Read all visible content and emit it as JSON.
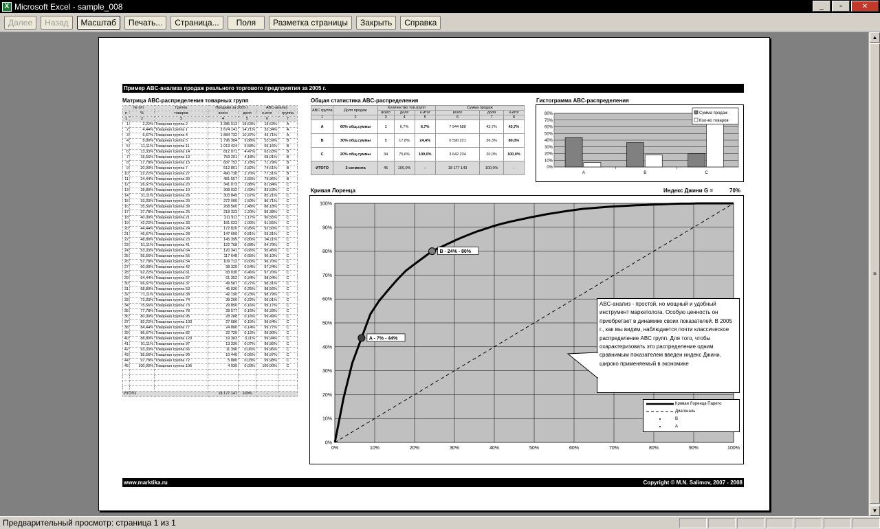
{
  "window": {
    "title": "Microsoft Excel - sample_008"
  },
  "toolbar": {
    "buttons": [
      "Далее",
      "Назад",
      "Масштаб",
      "Печать...",
      "Страница...",
      "Поля",
      "Разметка страницы",
      "Закрыть",
      "Справка"
    ]
  },
  "status": "Предварительный просмотр: страница 1 из 1",
  "sheet": {
    "header": "Пример ABC-анализа продаж реального торгового предприятия за 2005 г.",
    "footer_left": "www.marktika.ru",
    "footer_right": "Copyright © M.N. Salimov, 2007 - 2008",
    "matrix": {
      "title": "Матрица ABC-распределения товарных групп",
      "head1": [
        "№ п/п",
        "Группа",
        "Продажи за 2005 г.",
        "",
        "ABC-анализ",
        ""
      ],
      "head2": [
        "п",
        "%",
        "товаров",
        "всего",
        "доля",
        "н.итог",
        "группа"
      ],
      "head3": [
        "1",
        "2",
        "3",
        "4",
        "5",
        "6",
        "7"
      ],
      "rows": [
        [
          "1",
          "2,22%",
          "Товарная группа 2",
          "3 385 013",
          "18,63%",
          "18,63%",
          "A"
        ],
        [
          "2",
          "4,44%",
          "Товарная группа 1",
          "2 674 141",
          "14,71%",
          "33,34%",
          "A"
        ],
        [
          "3",
          "6,67%",
          "Товарная группа 4",
          "1 884 732",
          "10,37%",
          "43,71%",
          "A"
        ],
        [
          "4",
          "8,89%",
          "Товарная группа 5",
          "1 796 384",
          "9,88%",
          "53,59%",
          "B"
        ],
        [
          "5",
          "11,11%",
          "Товарная группа 11",
          "1 013 424",
          "5,58%",
          "59,16%",
          "B"
        ],
        [
          "6",
          "13,33%",
          "Товарная группа 14",
          "812 071",
          "4,47%",
          "63,63%",
          "B"
        ],
        [
          "7",
          "15,56%",
          "Товарная группа 13",
          "759 201",
          "4,18%",
          "68,01%",
          "B"
        ],
        [
          "8",
          "17,78%",
          "Товарная группа 15",
          "687 752",
          "3,78%",
          "71,79%",
          "B"
        ],
        [
          "9",
          "20,00%",
          "Товарная группа 7",
          "512 851",
          "2,82%",
          "74,61%",
          "B"
        ],
        [
          "10",
          "22,22%",
          "Товарная группа 27",
          "490 738",
          "2,70%",
          "77,31%",
          "B"
        ],
        [
          "11",
          "24,44%",
          "Товарная группа 30",
          "481 557",
          "2,65%",
          "79,96%",
          "B"
        ],
        [
          "12",
          "26,67%",
          "Товарная группа 20",
          "341 073",
          "1,88%",
          "81,84%",
          "C"
        ],
        [
          "13",
          "28,89%",
          "Товарная группа 10",
          "308 032",
          "1,69%",
          "83,53%",
          "C"
        ],
        [
          "14",
          "31,11%",
          "Товарная группа 26",
          "303 849",
          "1,67%",
          "85,21%",
          "C"
        ],
        [
          "15",
          "33,33%",
          "Товарная группа 29",
          "272 000",
          "1,50%",
          "86,71%",
          "C"
        ],
        [
          "16",
          "35,56%",
          "Товарная группа 39",
          "268 560",
          "1,48%",
          "88,18%",
          "C"
        ],
        [
          "17",
          "37,78%",
          "Товарная группа 25",
          "218 323",
          "1,20%",
          "89,38%",
          "C"
        ],
        [
          "18",
          "40,00%",
          "Товарная группа 21",
          "211 911",
          "1,17%",
          "90,55%",
          "C"
        ],
        [
          "19",
          "42,22%",
          "Товарная группа 33",
          "181 623",
          "1,00%",
          "91,55%",
          "C"
        ],
        [
          "20",
          "44,44%",
          "Товарная группа 24",
          "172 820",
          "0,95%",
          "92,50%",
          "C"
        ],
        [
          "21",
          "46,67%",
          "Товарная группа 28",
          "147 609",
          "0,81%",
          "93,31%",
          "C"
        ],
        [
          "22",
          "48,89%",
          "Товарная группа 23",
          "145 399",
          "0,80%",
          "94,11%",
          "C"
        ],
        [
          "23",
          "51,11%",
          "Товарная группа 41",
          "122 768",
          "0,68%",
          "94,79%",
          "C"
        ],
        [
          "24",
          "53,33%",
          "Товарная группа 64",
          "120 341",
          "0,66%",
          "95,45%",
          "C"
        ],
        [
          "25",
          "55,56%",
          "Товарная группа 56",
          "117 648",
          "0,65%",
          "96,10%",
          "C"
        ],
        [
          "26",
          "57,78%",
          "Товарная группа 54",
          "109 712",
          "0,60%",
          "96,70%",
          "C"
        ],
        [
          "27",
          "60,00%",
          "Товарная группа 42",
          "98 320",
          "0,54%",
          "97,24%",
          "C"
        ],
        [
          "28",
          "62,22%",
          "Товарная группа 61",
          "83 030",
          "0,46%",
          "97,70%",
          "C"
        ],
        [
          "29",
          "64,44%",
          "Товарная группа 67",
          "61 352",
          "0,34%",
          "98,04%",
          "C"
        ],
        [
          "30",
          "66,67%",
          "Товарная группа 37",
          "49 587",
          "0,27%",
          "98,31%",
          "C"
        ],
        [
          "31",
          "68,89%",
          "Товарная группа 53",
          "45 036",
          "0,25%",
          "98,56%",
          "C"
        ],
        [
          "32",
          "71,11%",
          "Товарная группа 38",
          "42 190",
          "0,23%",
          "98,79%",
          "C"
        ],
        [
          "33",
          "73,33%",
          "Товарная группа 74",
          "39 200",
          "0,22%",
          "99,01%",
          "C"
        ],
        [
          "34",
          "75,56%",
          "Товарная группа 73",
          "29 850",
          "0,16%",
          "99,17%",
          "C"
        ],
        [
          "35",
          "77,78%",
          "Товарная группа 78",
          "28 577",
          "0,16%",
          "99,33%",
          "C"
        ],
        [
          "36",
          "80,00%",
          "Товарная группа 95",
          "28 288",
          "0,16%",
          "99,49%",
          "C"
        ],
        [
          "37",
          "82,22%",
          "Товарная группа 103",
          "27 686",
          "0,15%",
          "99,64%",
          "C"
        ],
        [
          "38",
          "84,44%",
          "Товарная группа 77",
          "24 880",
          "0,14%",
          "99,77%",
          "C"
        ],
        [
          "39",
          "86,67%",
          "Товарная группа 82",
          "22 720",
          "0,12%",
          "99,90%",
          "C"
        ],
        [
          "40",
          "88,89%",
          "Товарная группа 129",
          "19 383",
          "0,11%",
          "99,94%",
          "C"
        ],
        [
          "41",
          "91,11%",
          "Товарная группа 97",
          "13 336",
          "0,07%",
          "99,95%",
          "C"
        ],
        [
          "42",
          "93,33%",
          "Товарная группа 66",
          "11 396",
          "0,06%",
          "99,96%",
          "C"
        ],
        [
          "43",
          "95,56%",
          "Товарная группа 99",
          "10 440",
          "0,06%",
          "99,97%",
          "C"
        ],
        [
          "44",
          "97,78%",
          "Товарная группа 72",
          "5 880",
          "0,03%",
          "99,98%",
          "C"
        ],
        [
          "45",
          "100,00%",
          "Товарная группа 106",
          "4 930",
          "0,03%",
          "100,00%",
          "C"
        ]
      ],
      "total": [
        "ИТОГО",
        "",
        "18 177 147",
        "100%",
        "-",
        ""
      ]
    },
    "stats": {
      "title": "Общая статистика ABC-распределения",
      "h1": [
        "ABC группа",
        "Доля продаж",
        "Количество тов.групп",
        "Сумма продаж"
      ],
      "h2": [
        "всего",
        "доля",
        "н.итог",
        "всего",
        "доля",
        "н.итог"
      ],
      "h3": [
        "1",
        "2",
        "3",
        "4",
        "5",
        "6",
        "7",
        "8"
      ],
      "rows": [
        [
          "A",
          "60% общ.суммы",
          "3",
          "6,7%",
          "6,7%",
          "7 944 688",
          "43,7%",
          "43,7%"
        ],
        [
          "B",
          "30% общ.суммы",
          "8",
          "17,8%",
          "24,4%",
          "6 590 221",
          "36,3%",
          "80,0%"
        ],
        [
          "C",
          "20% общ.суммы",
          "34",
          "75,6%",
          "100,0%",
          "3 642 234",
          "20,0%",
          "100,0%"
        ],
        [
          "ИТОГО",
          "3 сегмента",
          "45",
          "100,0%",
          "-",
          "18 177 143",
          "100,0%",
          "-"
        ]
      ]
    },
    "histogram": {
      "title": "Гистограмма ABC-распределения",
      "legend": [
        "Сумма продаж",
        "Кол-во товаров"
      ]
    },
    "lorenz": {
      "title": "Кривая Лоренца",
      "gini_label": "Индекс Джини G =",
      "gini_value": "70%",
      "pointA": "A - 7% - 44%",
      "pointB": "B - 24% - 80%",
      "legend": [
        "Кривая Лоренца Парето",
        "Диагональ",
        "B",
        "A"
      ],
      "callout": "ABC-анализ - простой, но мощный и удобный инструмент маркетолога. Особую ценность он приобретает в динамике своих показателей. В 2005 г., как мы видим, наблюдается почти классическое распределение ABC групп. Для того, чтобы охарактеризовать это распределение одним сравнимым показателем введен индекс Джини, широко применяемый в экономике"
    }
  },
  "chart_data": [
    {
      "type": "bar",
      "title": "Гистограмма ABC-распределения",
      "categories": [
        "A",
        "B",
        "C"
      ],
      "series": [
        {
          "name": "Сумма продаж",
          "values": [
            43.7,
            36.3,
            20.0
          ]
        },
        {
          "name": "Кол-во товаров",
          "values": [
            6.7,
            17.8,
            75.6
          ]
        }
      ],
      "ylim": [
        0,
        80
      ],
      "yticks": [
        "0%",
        "10%",
        "20%",
        "30%",
        "40%",
        "50%",
        "60%",
        "70%",
        "80%"
      ]
    },
    {
      "type": "line",
      "title": "Кривая Лоренца",
      "x": [
        0,
        2.2,
        4.4,
        6.7,
        8.9,
        11.1,
        13.3,
        15.6,
        17.8,
        20,
        22.2,
        24.4,
        26.7,
        28.9,
        31.1,
        33.3,
        35.6,
        37.8,
        40,
        42.2,
        44.4,
        46.7,
        48.9,
        51.1,
        53.3,
        55.6,
        57.8,
        60,
        62.2,
        64.4,
        66.7,
        68.9,
        71.1,
        73.3,
        75.6,
        77.8,
        80,
        82.2,
        84.4,
        86.7,
        88.9,
        91.1,
        93.3,
        95.6,
        97.8,
        100
      ],
      "series": [
        {
          "name": "Кривая Лоренца Парето",
          "values": [
            0,
            18.6,
            33.3,
            43.7,
            53.6,
            59.2,
            63.6,
            68.0,
            71.8,
            74.6,
            77.3,
            80.0,
            81.8,
            83.5,
            85.2,
            86.7,
            88.2,
            89.4,
            90.6,
            91.6,
            92.5,
            93.3,
            94.1,
            94.8,
            95.5,
            96.1,
            96.7,
            97.2,
            97.7,
            98.0,
            98.3,
            98.6,
            98.8,
            99.0,
            99.2,
            99.3,
            99.5,
            99.6,
            99.8,
            99.9,
            99.9,
            100,
            100,
            100,
            100,
            100
          ]
        },
        {
          "name": "Диагональ",
          "values": [
            0,
            100
          ]
        }
      ],
      "points": [
        {
          "label": "A - 7% - 44%",
          "x": 6.7,
          "y": 43.7
        },
        {
          "label": "B - 24% - 80%",
          "x": 24.4,
          "y": 80.0
        }
      ],
      "xticks": [
        "0%",
        "10%",
        "20%",
        "30%",
        "40%",
        "50%",
        "60%",
        "70%",
        "80%",
        "90%",
        "100%"
      ],
      "yticks": [
        "0%",
        "10%",
        "20%",
        "30%",
        "40%",
        "50%",
        "60%",
        "70%",
        "80%",
        "90%",
        "100%"
      ],
      "xlim": [
        0,
        100
      ],
      "ylim": [
        0,
        100
      ]
    }
  ]
}
